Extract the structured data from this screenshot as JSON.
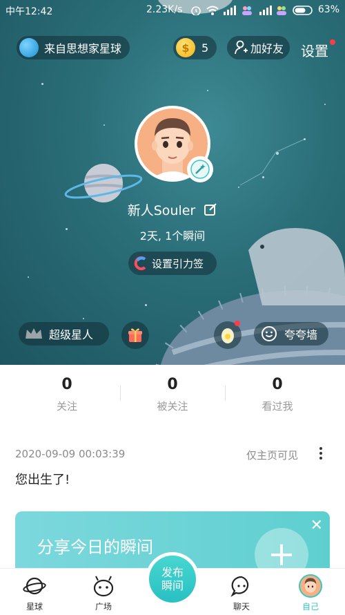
{
  "status_bar": {
    "time": "中午12:42",
    "speed": "2.23K/s",
    "battery": "63%"
  },
  "header": {
    "origin_label": "来自思想家星球",
    "coins": "5",
    "add_friend_label": "加好友",
    "settings_label": "设置"
  },
  "profile": {
    "username": "新人Souler",
    "meta": "2天, 1个瞬间",
    "tag_button": "设置引力签",
    "super_label": "超级星人",
    "praise_label": "夸夸墙"
  },
  "stats": [
    {
      "value": "0",
      "label": "关注"
    },
    {
      "value": "0",
      "label": "被关注"
    },
    {
      "value": "0",
      "label": "看过我"
    }
  ],
  "post": {
    "date": "2020-09-09 00:03:39",
    "visibility": "仅主页可见",
    "text": "您出生了!"
  },
  "share_card": {
    "title": "分享今日的瞬间"
  },
  "tabbar": {
    "planet": "星球",
    "square": "广场",
    "publish_line1": "发布",
    "publish_line2": "瞬间",
    "chat": "聊天",
    "me": "自己"
  },
  "colors": {
    "teal_bg": "#2b6f79",
    "accent": "#35c8c8",
    "red_dot": "#ff3b45"
  }
}
